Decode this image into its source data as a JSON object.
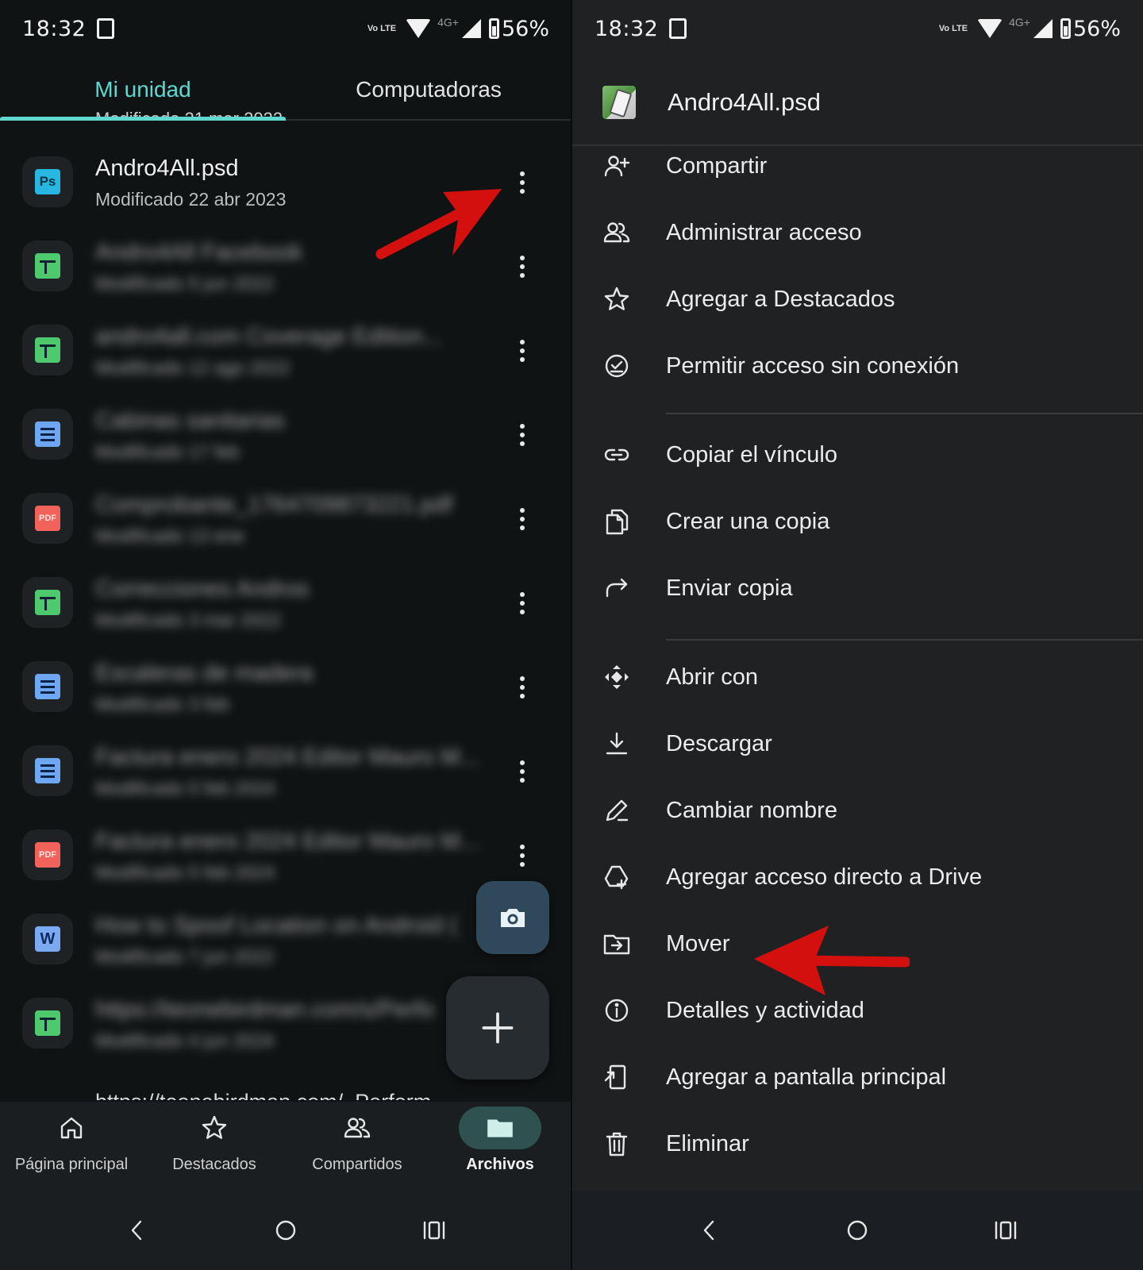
{
  "status_bar": {
    "time": "18:32",
    "volte": "Vo LTE",
    "network": "4G+",
    "battery": "56%"
  },
  "tabs": [
    {
      "label": "Mi unidad",
      "active": true
    },
    {
      "label": "Computadoras",
      "active": false
    }
  ],
  "peek_top_text": "Modificado 21 mar 2022",
  "files": [
    {
      "title": "Andro4All.psd",
      "subtitle": "Modificado 22 abr 2023",
      "type": "ps",
      "icon_text": "Ps",
      "blurred": false
    },
    {
      "title": "Andro4All Facebook",
      "subtitle": "Modificado 5 jun 2022",
      "type": "sheet",
      "blurred": true
    },
    {
      "title": "andro4all.com Coverage Edition...",
      "subtitle": "Modificado 12 ago 2022",
      "type": "sheet",
      "blurred": true
    },
    {
      "title": "Cabinas sanitarias",
      "subtitle": "Modificado 17 feb",
      "type": "doc",
      "blurred": true
    },
    {
      "title": "Comprobante_1764709873221.pdf",
      "subtitle": "Modificado 13 ene",
      "type": "pdf",
      "icon_text": "PDF",
      "blurred": true
    },
    {
      "title": "Correcciones Andros",
      "subtitle": "Modificado 3 mar 2022",
      "type": "sheet",
      "blurred": true
    },
    {
      "title": "Escaleras de madera",
      "subtitle": "Modificado 3 feb",
      "type": "doc",
      "blurred": true
    },
    {
      "title": "Factura enero 2024 Editor Mauro M...",
      "subtitle": "Modificado 5 feb 2024",
      "type": "doc",
      "blurred": true
    },
    {
      "title": "Factura enero 2024 Editor Mauro M...",
      "subtitle": "Modificado 5 feb 2024",
      "type": "pdf",
      "icon_text": "PDF",
      "blurred": true
    },
    {
      "title": "How to Spoof Location on Android (",
      "subtitle": "Modificado 7 jun 2022",
      "type": "word",
      "icon_text": "W",
      "blurred": true
    },
    {
      "title": "https://teonebirdman.com/s/Perfo",
      "subtitle": "Modificado 4 jun 2024",
      "type": "sheet",
      "blurred": true
    }
  ],
  "peek_bottom_text": "https://teonebirdman.com/_Perform",
  "bottom_nav": [
    {
      "label": "Página principal",
      "icon": "home-icon",
      "active": false
    },
    {
      "label": "Destacados",
      "icon": "star-icon",
      "active": false
    },
    {
      "label": "Compartidos",
      "icon": "people-icon",
      "active": false
    },
    {
      "label": "Archivos",
      "icon": "folder-icon",
      "active": true
    }
  ],
  "sheet": {
    "title": "Andro4All.psd",
    "items": [
      {
        "label": "Compartir",
        "icon": "person-add-icon"
      },
      {
        "label": "Administrar acceso",
        "icon": "manage-people-icon"
      },
      {
        "label": "Agregar a Destacados",
        "icon": "star-icon"
      },
      {
        "label": "Permitir acceso sin conexión",
        "icon": "offline-check-icon"
      },
      {
        "label": "Copiar el vínculo",
        "icon": "link-icon"
      },
      {
        "label": "Crear una copia",
        "icon": "copy-icon"
      },
      {
        "label": "Enviar copia",
        "icon": "forward-icon"
      },
      {
        "label": "Abrir con",
        "icon": "move-arrows-icon"
      },
      {
        "label": "Descargar",
        "icon": "download-icon"
      },
      {
        "label": "Cambiar nombre",
        "icon": "pencil-icon"
      },
      {
        "label": "Agregar acceso directo a Drive",
        "icon": "drive-shortcut-icon"
      },
      {
        "label": "Mover",
        "icon": "move-folder-icon"
      },
      {
        "label": "Detalles y actividad",
        "icon": "info-icon"
      },
      {
        "label": "Agregar a pantalla principal",
        "icon": "add-home-screen-icon"
      },
      {
        "label": "Eliminar",
        "icon": "trash-icon"
      }
    ]
  },
  "colors": {
    "accent": "#5fd8cf",
    "annotation_arrow": "#d4100f",
    "background": "#101314",
    "sheet_background": "#1f2123"
  }
}
